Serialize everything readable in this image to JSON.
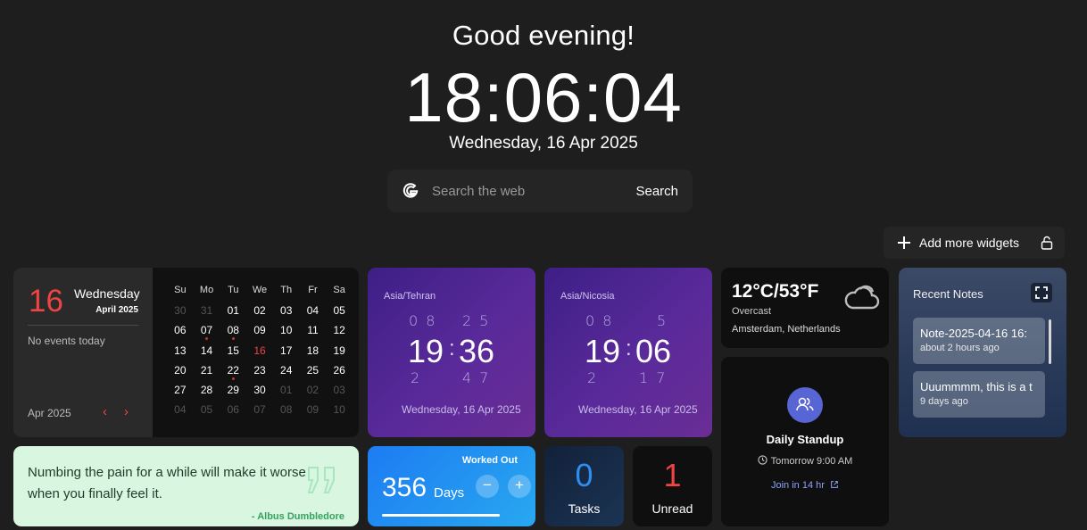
{
  "greeting": "Good evening!",
  "clock": "18:06:04",
  "date_line": "Wednesday, 16 Apr 2025",
  "search": {
    "placeholder": "Search the web",
    "button": "Search",
    "engine_icon": "google-icon"
  },
  "toolbar": {
    "add_widgets": "Add more widgets",
    "lock_icon": "lock-icon"
  },
  "calendar": {
    "day": "16",
    "weekday": "Wednesday",
    "month_year": "April 2025",
    "no_events": "No events today",
    "footer": "Apr 2025",
    "prev": "‹",
    "next": "›",
    "headers": [
      "Su",
      "Mo",
      "Tu",
      "We",
      "Th",
      "Fr",
      "Sa"
    ],
    "days": [
      {
        "d": "30",
        "muted": true
      },
      {
        "d": "31",
        "muted": true
      },
      {
        "d": "01"
      },
      {
        "d": "02"
      },
      {
        "d": "03"
      },
      {
        "d": "04"
      },
      {
        "d": "05"
      },
      {
        "d": "06"
      },
      {
        "d": "07",
        "dot": true
      },
      {
        "d": "08",
        "dot": true
      },
      {
        "d": "09"
      },
      {
        "d": "10"
      },
      {
        "d": "11"
      },
      {
        "d": "12"
      },
      {
        "d": "13"
      },
      {
        "d": "14"
      },
      {
        "d": "15"
      },
      {
        "d": "16",
        "today": true
      },
      {
        "d": "17"
      },
      {
        "d": "18"
      },
      {
        "d": "19"
      },
      {
        "d": "20"
      },
      {
        "d": "21"
      },
      {
        "d": "22",
        "dot": true
      },
      {
        "d": "23"
      },
      {
        "d": "24"
      },
      {
        "d": "25"
      },
      {
        "d": "26"
      },
      {
        "d": "27"
      },
      {
        "d": "28"
      },
      {
        "d": "29"
      },
      {
        "d": "30"
      },
      {
        "d": "01",
        "muted": true
      },
      {
        "d": "02",
        "muted": true
      },
      {
        "d": "03",
        "muted": true
      },
      {
        "d": "04",
        "muted": true
      },
      {
        "d": "05",
        "muted": true
      },
      {
        "d": "06",
        "muted": true
      },
      {
        "d": "07",
        "muted": true
      },
      {
        "d": "08",
        "muted": true
      },
      {
        "d": "09",
        "muted": true
      },
      {
        "d": "10",
        "muted": true
      }
    ]
  },
  "world_clocks": [
    {
      "tz": "Asia/Tehran",
      "prev_h": "0 8",
      "prev_m": "2 5",
      "hour": "19",
      "minute": "36",
      "next_h": "2",
      "next_m": "4 7",
      "date": "Wednesday, 16 Apr 2025"
    },
    {
      "tz": "Asia/Nicosia",
      "prev_h": "0 8",
      "prev_m": "5",
      "hour": "19",
      "minute": "06",
      "next_h": "2",
      "next_m": "1 7",
      "date": "Wednesday, 16 Apr 2025"
    }
  ],
  "weather": {
    "temp": "12°C/53°F",
    "condition": "Overcast",
    "location": "Amsterdam, Netherlands",
    "icon": "cloud-icon"
  },
  "notes": {
    "title": "Recent Notes",
    "items": [
      {
        "title": "Note-2025-04-16 16:",
        "subtitle": "about 2 hours ago"
      },
      {
        "title": "Uuummmm, this is a t",
        "subtitle": "9 days ago"
      }
    ]
  },
  "standup": {
    "name": "Daily Standup",
    "when": "Tomorrow 9:00 AM",
    "join": "Join in 14 hr"
  },
  "quote": {
    "text": "Numbing the pain for a while will make it worse when you finally feel it.",
    "author": "- Albus Dumbledore"
  },
  "workout": {
    "label": "Worked Out",
    "count": "356",
    "unit": "Days",
    "minus": "−",
    "plus": "+",
    "accent": "#1d7cf2"
  },
  "tasks": {
    "count": "0",
    "label": "Tasks"
  },
  "unread": {
    "count": "1",
    "label": "Unread"
  },
  "colors": {
    "accent_red": "#ef4444",
    "clock_purple": "#4b2590",
    "quote_green": "#d8f6e0"
  }
}
